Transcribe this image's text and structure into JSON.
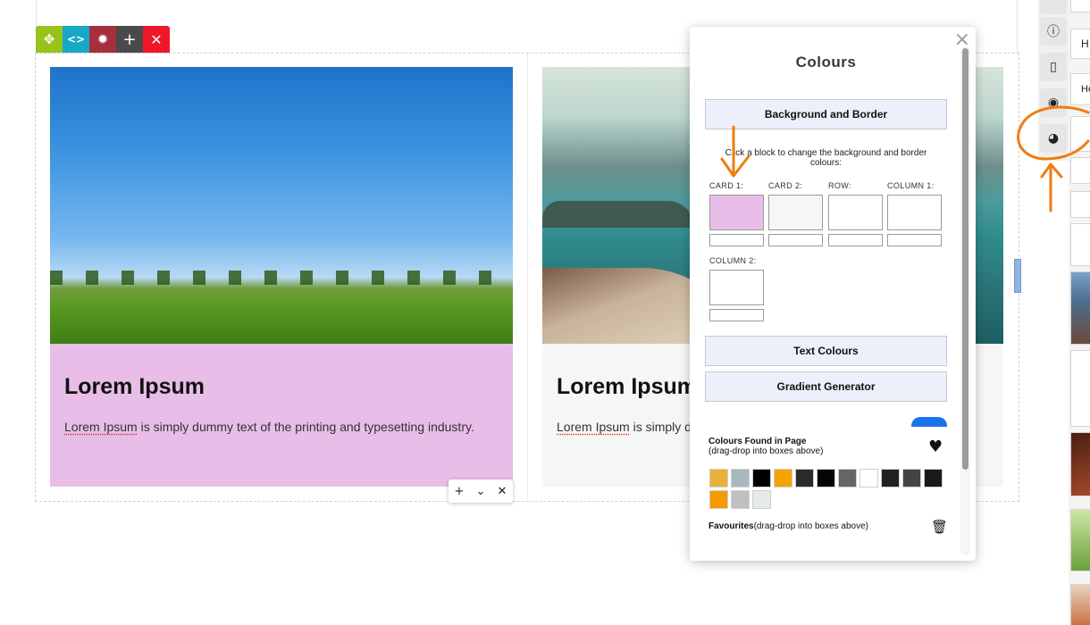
{
  "row_toolbar": {
    "move_icon": "✥",
    "code_icon": "<>",
    "gear_icon": "✹",
    "add_icon": "+",
    "delete_icon": "✕"
  },
  "cards": [
    {
      "title": "Lorem Ipsum",
      "text_lead": "Lorem Ipsum",
      "text_rest": " is simply dummy text of the printing and typesetting industry."
    },
    {
      "title": "Lorem Ipsum",
      "text_lead": "Lorem Ipsum",
      "text_rest": " is simply d"
    }
  ],
  "block_toolbar": {
    "add": "+",
    "down": "⌄",
    "close": "✕"
  },
  "panel": {
    "close": "×",
    "title": "Colours",
    "section_bg": "Background and Border",
    "hint": "Click a block to change the background and border colours:",
    "slots": [
      {
        "label": "CARD 1:",
        "color": "#e8bde8"
      },
      {
        "label": "CARD 2:",
        "color": "#f6f6f6"
      },
      {
        "label": "ROW:",
        "color": "#ffffff"
      },
      {
        "label": "COLUMN 1:",
        "color": "#ffffff"
      },
      {
        "label": "COLUMN 2:",
        "color": "#ffffff"
      }
    ],
    "section_text": "Text Colours",
    "section_gradient": "Gradient Generator",
    "found_title": "Colours Found in Page",
    "found_sub": "(drag-drop into boxes above)",
    "found_colors": [
      "#e8b23a",
      "#a8b8c0",
      "#000000",
      "#f5a300",
      "#2b2b2b",
      "#050505",
      "#666666",
      "#ffffff",
      "#222222",
      "#444444",
      "#1a1a1a",
      "#f59a00",
      "#c0c0c0",
      "#e6eaea"
    ],
    "fav_title": "Favourites",
    "fav_sub": "(drag-drop into boxes above)",
    "heart_icon": "♥",
    "trash_icon": "🗑"
  },
  "sidebar": {
    "info_icon": "ⓘ",
    "phone_icon": "▯",
    "aperture_icon": "◉",
    "palette_icon": "◕",
    "text_h1": "H",
    "text_h2": "He"
  },
  "colors": {
    "annotation": "#f07d12",
    "accent": "#1a73e8"
  }
}
